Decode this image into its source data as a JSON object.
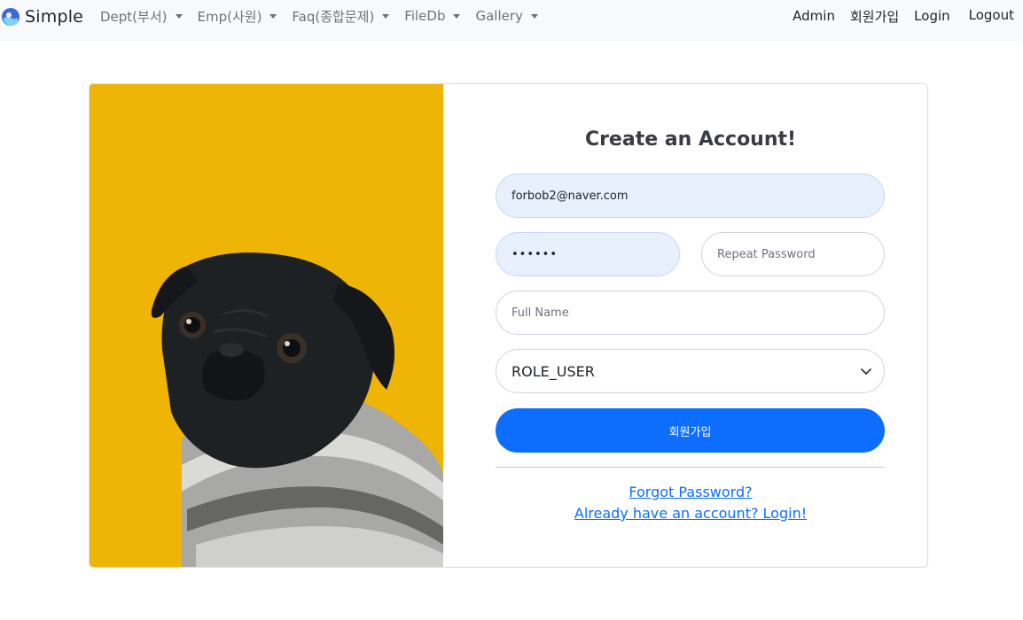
{
  "navbar": {
    "brand": "Simple",
    "left_items": [
      {
        "label": "Dept(부서)"
      },
      {
        "label": "Emp(사원)"
      },
      {
        "label": "Faq(종합문제)"
      },
      {
        "label": "FileDb"
      },
      {
        "label": "Gallery"
      }
    ],
    "right_items": {
      "admin": "Admin",
      "signup": "회원가입",
      "login": "Login",
      "logout": "Logout"
    }
  },
  "register": {
    "title": "Create an Account!",
    "email_value": "forbob2@naver.com",
    "password_value": "••••••",
    "repeat_password_placeholder": "Repeat Password",
    "full_name_placeholder": "Full Name",
    "role_selected": "ROLE_USER",
    "submit_label": "회원가입",
    "forgot_link": "Forgot Password?",
    "login_link": "Already have an account? Login!"
  },
  "colors": {
    "primary": "#0d6efd",
    "photo_bg": "#efb506",
    "navbar_bg": "#f8f9fa",
    "autofill_bg": "#e8f0fe"
  },
  "icons": {
    "brand": "brand-logo-icon",
    "dropdown": "caret-down-icon",
    "select": "chevron-down-icon"
  }
}
